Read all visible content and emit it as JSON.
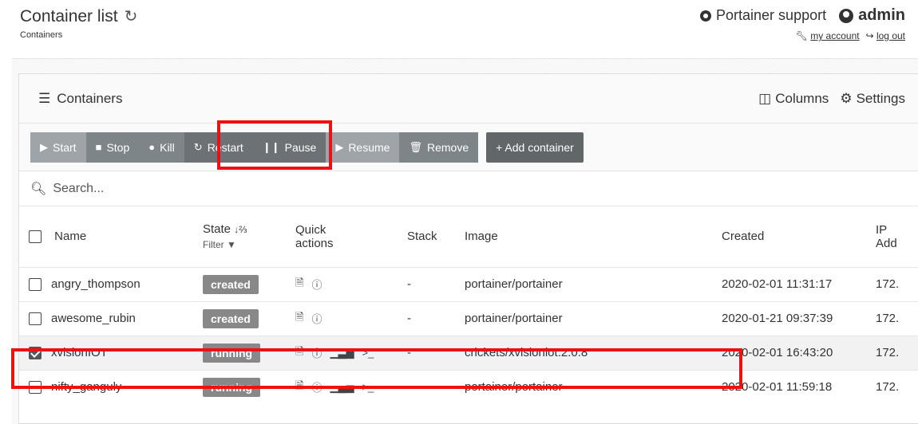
{
  "header": {
    "title": "Container list",
    "breadcrumb": "Containers",
    "support_label": "Portainer support",
    "user": "admin",
    "my_account": "my account",
    "log_out": "log out"
  },
  "widget": {
    "title": "Containers",
    "columns_label": "Columns",
    "settings_label": "Settings"
  },
  "actions": {
    "start": "Start",
    "stop": "Stop",
    "kill": "Kill",
    "restart": "Restart",
    "pause": "Pause",
    "resume": "Resume",
    "remove": "Remove",
    "add": "+ Add container"
  },
  "search": {
    "placeholder": "Search..."
  },
  "table": {
    "headers": {
      "name": "Name",
      "state": "State",
      "state_sort": "↓⅔",
      "filter": "Filter",
      "quick1": "Quick",
      "quick2": "actions",
      "stack": "Stack",
      "image": "Image",
      "created": "Created",
      "ip1": "IP",
      "ip2": "Add"
    },
    "rows": [
      {
        "name": "angry_thompson",
        "state": "created",
        "stack": "-",
        "image": "portainer/portainer",
        "created": "2020-02-01 11:31:17",
        "ip": "172.",
        "checked": false
      },
      {
        "name": "awesome_rubin",
        "state": "created",
        "stack": "-",
        "image": "portainer/portainer",
        "created": "2020-01-21 09:37:39",
        "ip": "172.",
        "checked": false
      },
      {
        "name": "xvisionIOT",
        "state": "running",
        "stack": "-",
        "image": "crickets/xvisioniot:2.0.8",
        "created": "2020-02-01 16:43:20",
        "ip": "172.",
        "checked": true
      },
      {
        "name": "nifty_ganguly",
        "state": "running",
        "stack": "-",
        "image": "portainer/portainer",
        "created": "2020-02-01 11:59:18",
        "ip": "172.",
        "checked": false
      }
    ]
  },
  "colors": {
    "highlight": "#ee1111",
    "button": "#9ea4a8",
    "badge": "#888888"
  }
}
